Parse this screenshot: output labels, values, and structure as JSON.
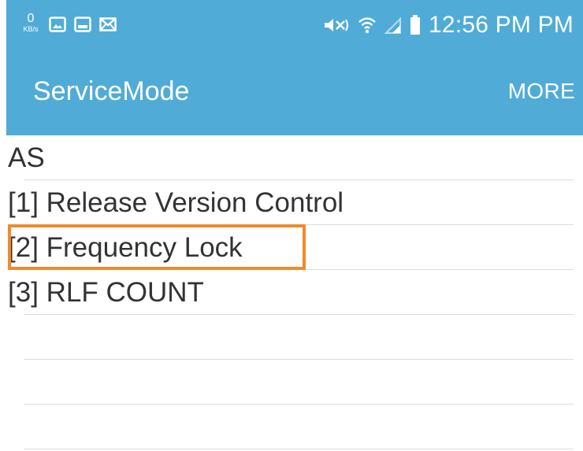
{
  "status_bar": {
    "speed_value": "0",
    "speed_unit": "KB/s",
    "left_icons": [
      "image-icon",
      "screen-icon",
      "mail-icon"
    ],
    "right_icons": [
      "mute-icon",
      "wifi-icon",
      "signal-icon",
      "battery-icon"
    ],
    "time": "12:56 PM PM"
  },
  "app_bar": {
    "title": "ServiceMode",
    "more_label": "MORE"
  },
  "list": {
    "items": [
      {
        "label": "AS"
      },
      {
        "label": "[1] Release Version Control"
      },
      {
        "label": "[2] Frequency Lock"
      },
      {
        "label": "[3] RLF COUNT"
      },
      {
        "label": ""
      },
      {
        "label": ""
      },
      {
        "label": ""
      }
    ]
  },
  "colors": {
    "header_blue": "#50acd6",
    "highlight_orange": "#f08a2c",
    "text": "#333333",
    "divider": "#dcdcdc"
  }
}
